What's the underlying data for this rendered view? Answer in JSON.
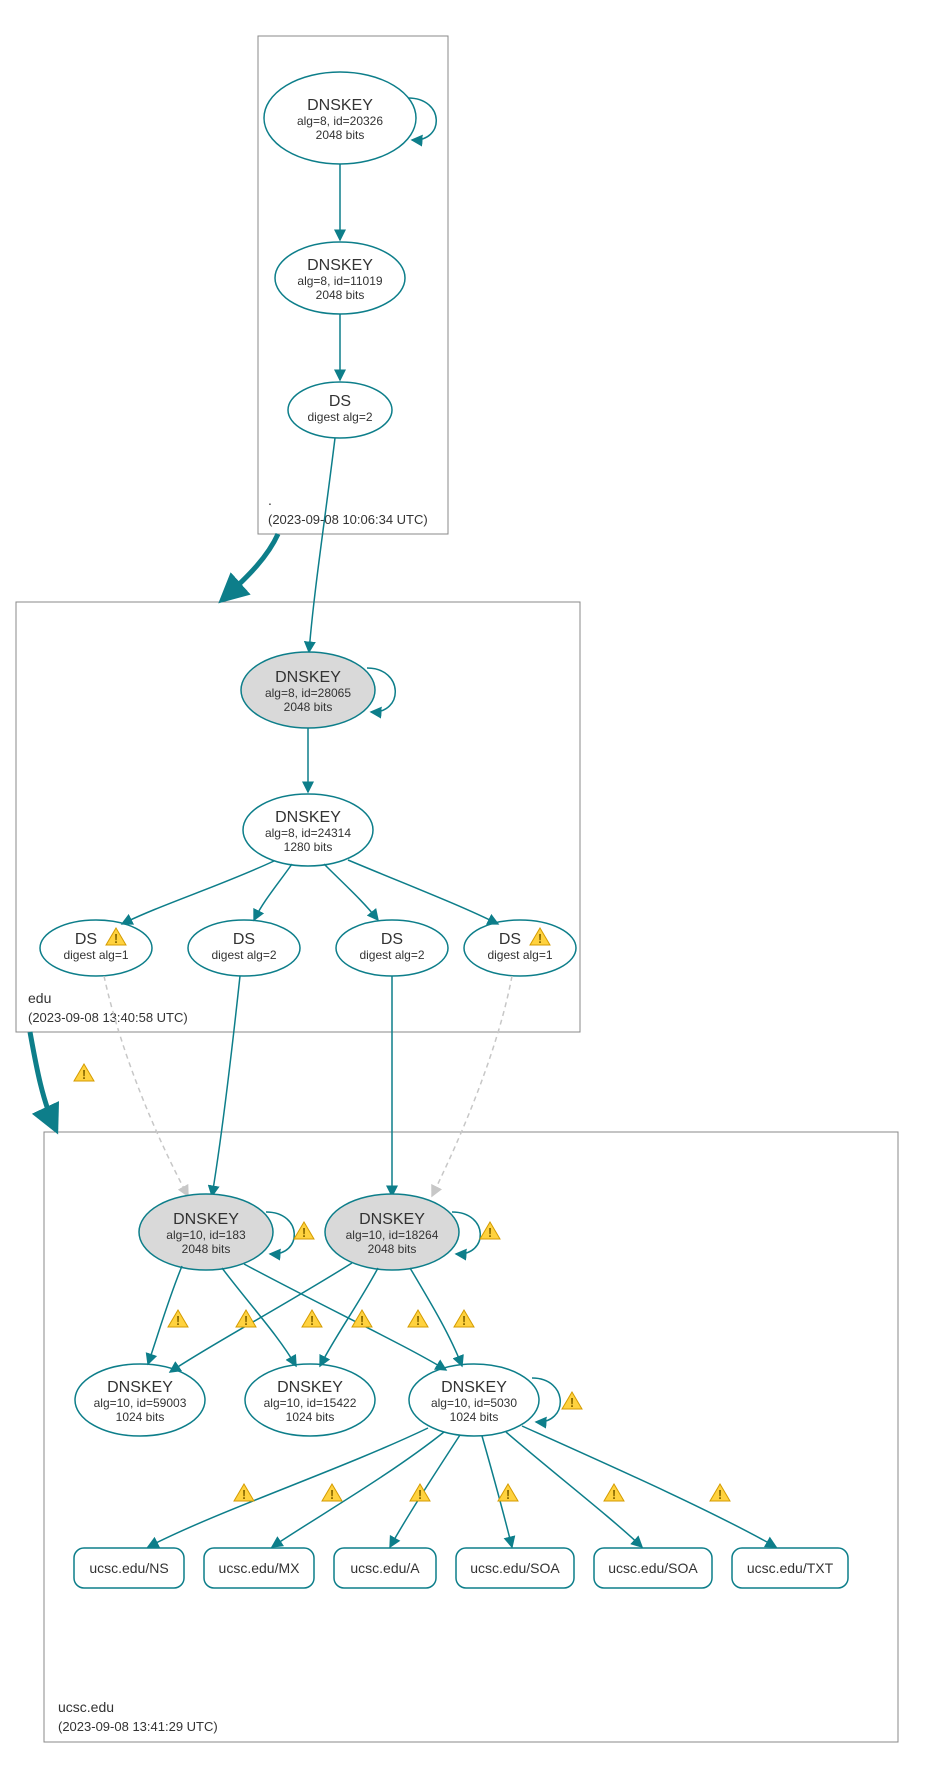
{
  "zones": {
    "root": {
      "name": ".",
      "timestamp": "(2023-09-08 10:06:34 UTC)",
      "nodes": {
        "dnskey_20326": {
          "title": "DNSKEY",
          "line2": "alg=8, id=20326",
          "line3": "2048 bits"
        },
        "dnskey_11019": {
          "title": "DNSKEY",
          "line2": "alg=8, id=11019",
          "line3": "2048 bits"
        },
        "ds_edu": {
          "title": "DS",
          "line2": "digest alg=2"
        }
      }
    },
    "edu": {
      "name": "edu",
      "timestamp": "(2023-09-08 13:40:58 UTC)",
      "nodes": {
        "dnskey_28065": {
          "title": "DNSKEY",
          "line2": "alg=8, id=28065",
          "line3": "2048 bits"
        },
        "dnskey_24314": {
          "title": "DNSKEY",
          "line2": "alg=8, id=24314",
          "line3": "1280 bits"
        },
        "ds1": {
          "title": "DS",
          "line2": "digest alg=1",
          "warn": true
        },
        "ds2": {
          "title": "DS",
          "line2": "digest alg=2"
        },
        "ds3": {
          "title": "DS",
          "line2": "digest alg=2"
        },
        "ds4": {
          "title": "DS",
          "line2": "digest alg=1",
          "warn": true
        }
      }
    },
    "ucsc": {
      "name": "ucsc.edu",
      "timestamp": "(2023-09-08 13:41:29 UTC)",
      "nodes": {
        "dnskey_183": {
          "title": "DNSKEY",
          "line2": "alg=10, id=183",
          "line3": "2048 bits"
        },
        "dnskey_18264": {
          "title": "DNSKEY",
          "line2": "alg=10, id=18264",
          "line3": "2048 bits"
        },
        "dnskey_59003": {
          "title": "DNSKEY",
          "line2": "alg=10, id=59003",
          "line3": "1024 bits"
        },
        "dnskey_15422": {
          "title": "DNSKEY",
          "line2": "alg=10, id=15422",
          "line3": "1024 bits"
        },
        "dnskey_5030": {
          "title": "DNSKEY",
          "line2": "alg=10, id=5030",
          "line3": "1024 bits"
        }
      },
      "rrsets": {
        "ns": "ucsc.edu/NS",
        "mx": "ucsc.edu/MX",
        "a": "ucsc.edu/A",
        "soa1": "ucsc.edu/SOA",
        "soa2": "ucsc.edu/SOA",
        "txt": "ucsc.edu/TXT"
      }
    }
  }
}
